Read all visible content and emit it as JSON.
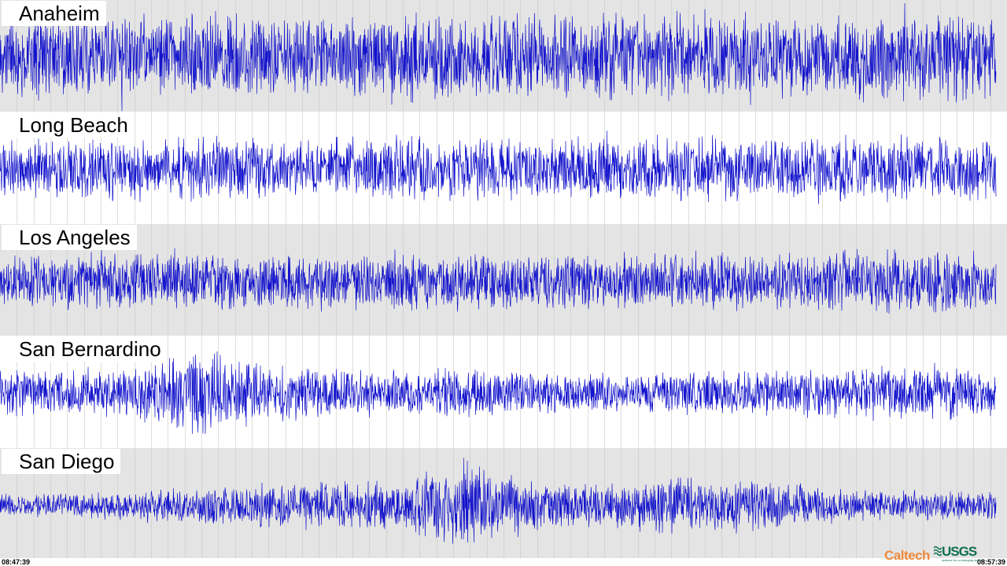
{
  "colors": {
    "trace": "#1414cc",
    "panel_shaded": "#e4e4e4",
    "panel_plain": "#ffffff",
    "gridline": "#c8c8c8",
    "caltech": "#ef8a3b",
    "usgs": "#0f6f4f"
  },
  "chart_data": {
    "type": "line",
    "title": "",
    "x_range": [
      "08:47:39",
      "08:57:39"
    ],
    "grid": true,
    "stations": [
      {
        "name": "Anaheim",
        "envelope": [
          0.85,
          0.9,
          0.88,
          0.92,
          0.9,
          0.87,
          0.93,
          0.9,
          0.88,
          0.91,
          0.89,
          0.92,
          0.9,
          0.88,
          0.9,
          0.91
        ],
        "shaded": true
      },
      {
        "name": "Long Beach",
        "envelope": [
          0.6,
          0.65,
          0.62,
          0.66,
          0.64,
          0.62,
          0.68,
          0.65,
          0.63,
          0.67,
          0.66,
          0.64,
          0.68,
          0.66,
          0.7,
          0.65
        ],
        "shaded": false
      },
      {
        "name": "Los Angeles",
        "envelope": [
          0.55,
          0.6,
          0.62,
          0.65,
          0.6,
          0.58,
          0.62,
          0.6,
          0.55,
          0.6,
          0.62,
          0.58,
          0.6,
          0.62,
          0.65,
          0.6
        ],
        "shaded": true
      },
      {
        "name": "San Bernardino",
        "envelope": [
          0.5,
          0.5,
          0.52,
          0.95,
          0.6,
          0.5,
          0.45,
          0.5,
          0.45,
          0.4,
          0.42,
          0.45,
          0.5,
          0.55,
          0.55,
          0.5
        ],
        "shaded": false
      },
      {
        "name": "San Diego",
        "envelope": [
          0.25,
          0.25,
          0.3,
          0.35,
          0.45,
          0.5,
          0.55,
          0.95,
          0.5,
          0.45,
          0.6,
          0.55,
          0.45,
          0.35,
          0.3,
          0.3
        ],
        "shaded": true
      }
    ]
  },
  "footer": {
    "time_start": "08:47:39",
    "time_end": "08:57:39",
    "logo_caltech": "Caltech",
    "logo_usgs": "USGS",
    "usgs_tagline": "science for a changing world"
  }
}
